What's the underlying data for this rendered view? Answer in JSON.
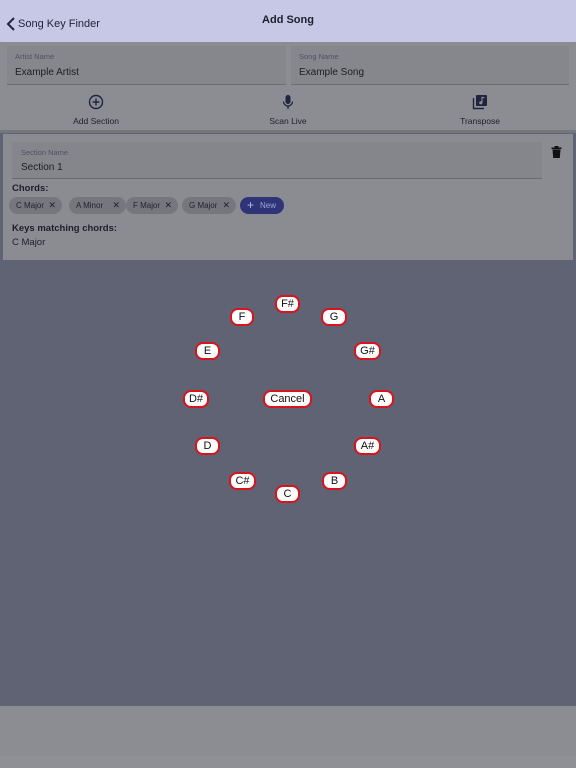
{
  "nav": {
    "back_label": "Song Key Finder",
    "title": "Add Song"
  },
  "form": {
    "artist_label": "Artist Name",
    "artist_value": "Example Artist",
    "song_label": "Song Name",
    "song_value": "Example Song"
  },
  "actions": {
    "add_section": "Add Section",
    "scan_live": "Scan Live",
    "transpose": "Transpose"
  },
  "section": {
    "name_label": "Section Name",
    "name_value": "Section 1",
    "chords_label": "Chords:",
    "chords": [
      "C Major",
      "A Minor",
      "F Major",
      "G Major"
    ],
    "new_label": "New",
    "keys_label": "Keys matching chords:",
    "keys_value": "C Major"
  },
  "picker": {
    "notes": [
      "F#",
      "G",
      "G#",
      "A",
      "A#",
      "B",
      "C",
      "C#",
      "D",
      "D#",
      "E",
      "F"
    ],
    "cancel_label": "Cancel"
  },
  "colors": {
    "nav_bg": "#c7c8e6",
    "overlay_bg": "#5f6373",
    "accent": "#2f3478",
    "note_border": "#d8141d"
  },
  "icons": [
    "chevron-left-icon",
    "plus-circle-icon",
    "microphone-icon",
    "music-library-icon",
    "trash-icon",
    "close-icon",
    "plus-icon"
  ]
}
